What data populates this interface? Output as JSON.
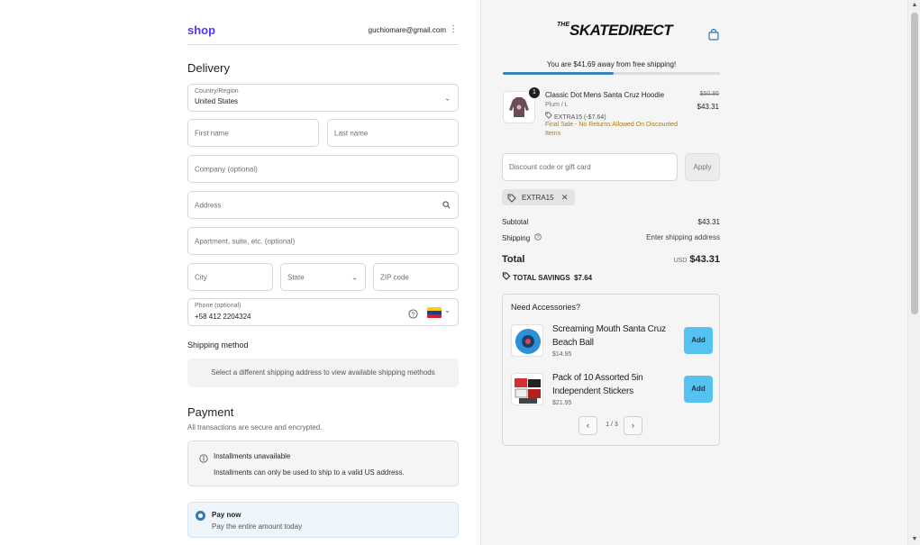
{
  "header": {
    "shop_logo": "shop",
    "email": "guchiomare@gmail.com"
  },
  "delivery": {
    "title": "Delivery",
    "country_label": "Country/Region",
    "country_value": "United States",
    "first_name_placeholder": "First name",
    "last_name_placeholder": "Last name",
    "company_placeholder": "Company (optional)",
    "address_placeholder": "Address",
    "apartment_placeholder": "Apartment, suite, etc. (optional)",
    "city_placeholder": "City",
    "state_placeholder": "State",
    "zip_placeholder": "ZIP code",
    "phone_label": "Phone (optional)",
    "phone_value": "+58 412 2204324"
  },
  "shipping_method": {
    "title": "Shipping method",
    "message": "Select a different shipping address to view available shipping methods"
  },
  "payment": {
    "title": "Payment",
    "subtitle": "All transactions are secure and encrypted.",
    "installments_title": "Installments unavailable",
    "installments_text": "Installments can only be used to ship to a valid US address.",
    "pay_now_title": "Pay now",
    "pay_now_sub": "Pay the entire amount today"
  },
  "summary": {
    "brand_small": "THE",
    "brand": "SKATEDIRECT",
    "free_shipping": "You are $41.69 away from free shipping!",
    "free_shipping_progress": 0.51,
    "item": {
      "qty": "1",
      "title": "Classic Dot Mens Santa Cruz Hoodie",
      "variant": "Plum / L",
      "discount": "EXTRA15 (-$7.64)",
      "note": "Final Sale - No Returns Allowed On Discounted Items",
      "price_old": "$50.95",
      "price_new": "$43.31"
    },
    "discount_placeholder": "Discount code or gift card",
    "apply_label": "Apply",
    "applied_code": "EXTRA15",
    "subtotal_label": "Subtotal",
    "subtotal_value": "$43.31",
    "shipping_label": "Shipping",
    "shipping_value": "Enter shipping address",
    "total_label": "Total",
    "total_currency": "USD",
    "total_value": "$43.31",
    "savings": "TOTAL SAVINGS  $7.64"
  },
  "accessories": {
    "title": "Need Accessories?",
    "items": [
      {
        "name": "Screaming Mouth Santa Cruz Beach Ball",
        "price": "$14.95",
        "add_label": "Add"
      },
      {
        "name": "Pack of 10 Assorted 5in Independent Stickers",
        "price": "$21.95",
        "add_label": "Add"
      }
    ],
    "pager": "1 / 3"
  },
  "colors": {
    "accent": "#2e7ab8",
    "shop_purple": "#5a31f4",
    "add_button": "#55c3f2",
    "warning_text": "#b07a00"
  }
}
